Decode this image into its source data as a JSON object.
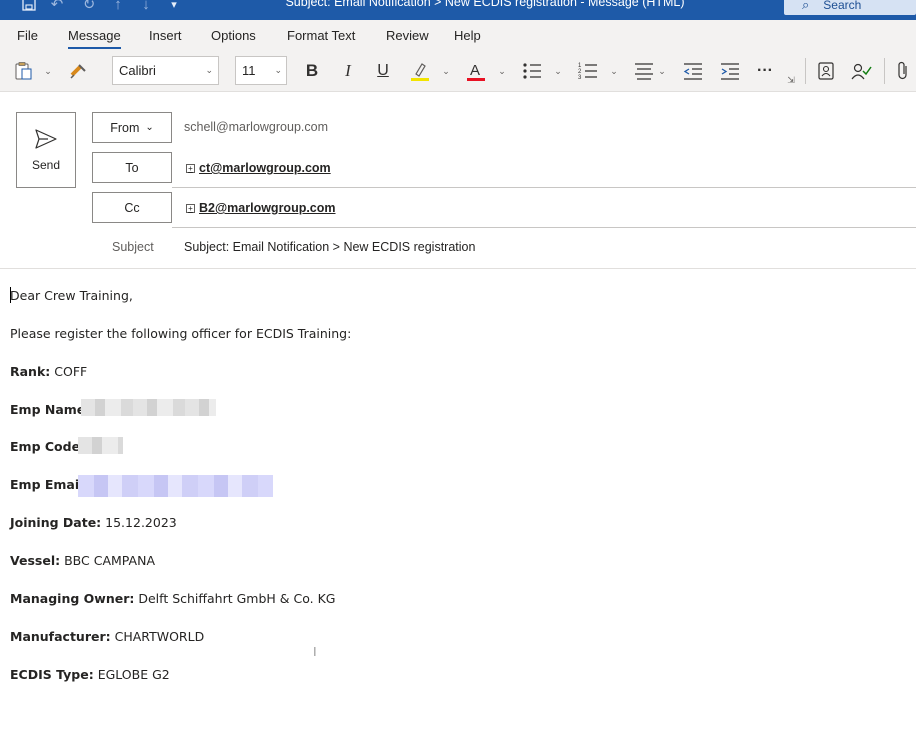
{
  "window": {
    "title": "Subject: Email Notification > New ECDIS registration  -  Message (HTML)",
    "search_placeholder": "Search"
  },
  "menu": {
    "tabs": [
      "File",
      "Message",
      "Insert",
      "Options",
      "Format Text",
      "Review",
      "Help"
    ],
    "active": "Message"
  },
  "ribbon": {
    "font_name": "Calibri",
    "font_size": "11",
    "bold": "B",
    "italic": "I",
    "underline": "U",
    "font_color_glyph": "A",
    "highlight_color": "#f2e400",
    "font_color": "#e81123"
  },
  "compose": {
    "send_label": "Send",
    "from_label": "From",
    "from_value": "schell@marlowgroup.com",
    "to_label": "To",
    "to_value": "ct@marlowgroup.com",
    "cc_label": "Cc",
    "cc_value": "B2@marlowgroup.com",
    "subject_label": "Subject",
    "subject_value": "Subject: Email Notification > New ECDIS registration"
  },
  "body": {
    "greeting": "Dear Crew Training,",
    "intro": "Please register the following officer for ECDIS Training:",
    "fields": {
      "rank_label": "Rank:",
      "rank_value": "COFF",
      "emp_name_label": "Emp Name:",
      "emp_code_label": "Emp Code:",
      "emp_email_label": "Emp Email:",
      "joining_date_label": "Joining Date:",
      "joining_date_value": "15.12.2023",
      "vessel_label": "Vessel:",
      "vessel_value": "BBC CAMPANA",
      "managing_owner_label": "Managing Owner:",
      "managing_owner_value": "Delft Schiffahrt GmbH & Co. KG",
      "manufacturer_label": "Manufacturer:",
      "manufacturer_value": "CHARTWORLD",
      "ecdis_type_label": "ECDIS Type:",
      "ecdis_type_value": "EGLOBE G2"
    }
  }
}
